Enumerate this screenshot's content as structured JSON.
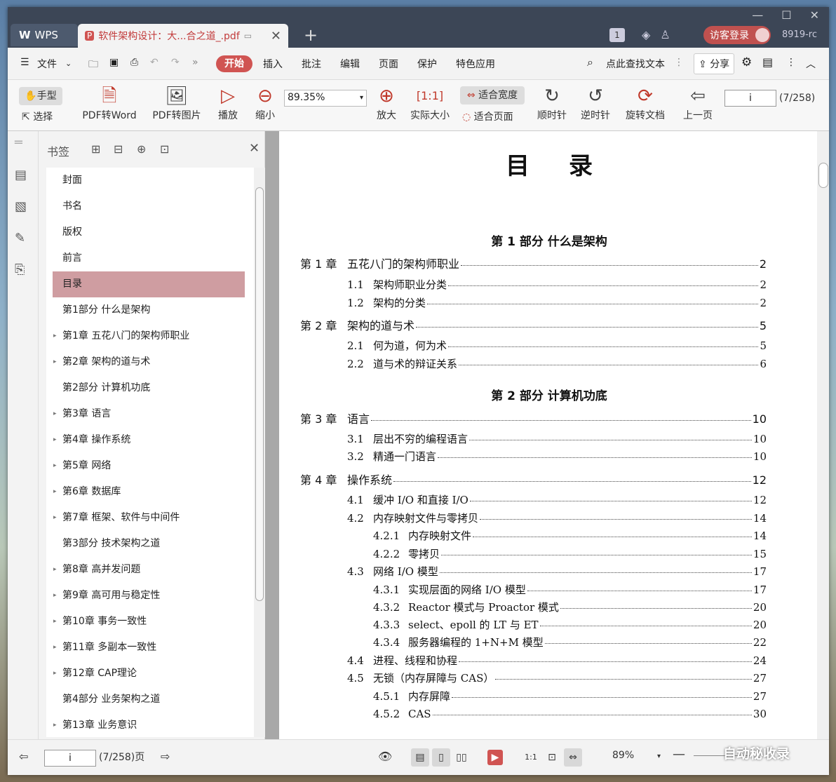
{
  "titlebar": {
    "app_tab": "WPS",
    "doc_tab": "软件架构设计：大...合之道_.pdf",
    "badge": "1",
    "login": "访客登录",
    "version": "8919-rc"
  },
  "menu": {
    "file": "文件",
    "start": "开始",
    "insert": "插入",
    "annotate": "批注",
    "edit": "编辑",
    "page": "页面",
    "protect": "保护",
    "special": "特色应用",
    "search": "点此查找文本",
    "share": "分享"
  },
  "ribbon": {
    "hand": "手型",
    "select": "选择",
    "pdf_word": "PDF转Word",
    "pdf_img": "PDF转图片",
    "play": "播放",
    "zoom_out": "缩小",
    "zoom_value": "89.35%",
    "zoom_in": "放大",
    "actual": "实际大小",
    "fit_width": "适合宽度",
    "fit_page": "适合页面",
    "cw": "顺时针",
    "ccw": "逆时针",
    "rotate": "旋转文档",
    "prev": "上一页",
    "page_input": "i",
    "page_count": "(7/258)"
  },
  "bookmarks": {
    "title": "书签",
    "items": [
      {
        "label": "封面",
        "arrow": ""
      },
      {
        "label": "书名",
        "arrow": ""
      },
      {
        "label": "版权",
        "arrow": ""
      },
      {
        "label": "前言",
        "arrow": ""
      },
      {
        "label": "目录",
        "arrow": "",
        "selected": true
      },
      {
        "label": "第1部分  什么是架构",
        "arrow": ""
      },
      {
        "label": "第1章  五花八门的架构师职业",
        "arrow": "▸"
      },
      {
        "label": "第2章  架构的道与术",
        "arrow": "▸"
      },
      {
        "label": "第2部分  计算机功底",
        "arrow": ""
      },
      {
        "label": "第3章  语言",
        "arrow": "▸"
      },
      {
        "label": "第4章  操作系统",
        "arrow": "▸"
      },
      {
        "label": "第5章  网络",
        "arrow": "▸"
      },
      {
        "label": "第6章  数据库",
        "arrow": "▸"
      },
      {
        "label": "第7章  框架、软件与中间件",
        "arrow": "▸"
      },
      {
        "label": "第3部分  技术架构之道",
        "arrow": ""
      },
      {
        "label": "第8章  高并发问题",
        "arrow": "▸"
      },
      {
        "label": "第9章  高可用与稳定性",
        "arrow": "▸"
      },
      {
        "label": "第10章  事务一致性",
        "arrow": "▸"
      },
      {
        "label": "第11章  多副本一致性",
        "arrow": "▸"
      },
      {
        "label": "第12章  CAP理论",
        "arrow": "▸"
      },
      {
        "label": "第4部分  业务架构之道",
        "arrow": ""
      },
      {
        "label": "第13章  业务意识",
        "arrow": "▸"
      }
    ]
  },
  "doc": {
    "title": "目录",
    "part1": "第 1 部分    什么是架构",
    "part2": "第 2 部分    计算机功底",
    "toc": [
      {
        "num": "第 1 章",
        "text": "五花八门的架构师职业",
        "page": "2",
        "level": 0
      },
      {
        "num": "1.1",
        "text": "架构师职业分类",
        "page": "2",
        "level": 1
      },
      {
        "num": "1.2",
        "text": "架构的分类",
        "page": "2",
        "level": 1
      },
      {
        "num": "第 2 章",
        "text": "架构的道与术",
        "page": "5",
        "level": 0
      },
      {
        "num": "2.1",
        "text": "何为道，何为术",
        "page": "5",
        "level": 1
      },
      {
        "num": "2.2",
        "text": "道与术的辩证关系",
        "page": "6",
        "level": 1
      },
      {
        "num": "第 3 章",
        "text": "语言",
        "page": "10",
        "level": 0
      },
      {
        "num": "3.1",
        "text": "层出不穷的编程语言",
        "page": "10",
        "level": 1
      },
      {
        "num": "3.2",
        "text": "精通一门语言",
        "page": "10",
        "level": 1
      },
      {
        "num": "第 4 章",
        "text": "操作系统",
        "page": "12",
        "level": 0
      },
      {
        "num": "4.1",
        "text": "缓冲 I/O 和直接 I/O",
        "page": "12",
        "level": 1
      },
      {
        "num": "4.2",
        "text": "内存映射文件与零拷贝",
        "page": "14",
        "level": 1
      },
      {
        "num": "4.2.1",
        "text": "内存映射文件",
        "page": "14",
        "level": 2
      },
      {
        "num": "4.2.2",
        "text": "零拷贝",
        "page": "15",
        "level": 2
      },
      {
        "num": "4.3",
        "text": "网络 I/O 模型",
        "page": "17",
        "level": 1
      },
      {
        "num": "4.3.1",
        "text": "实现层面的网络 I/O 模型",
        "page": "17",
        "level": 2
      },
      {
        "num": "4.3.2",
        "text": "Reactor 模式与 Proactor 模式",
        "page": "20",
        "level": 2
      },
      {
        "num": "4.3.3",
        "text": "select、epoll 的 LT 与 ET",
        "page": "20",
        "level": 2
      },
      {
        "num": "4.3.4",
        "text": "服务器编程的 1+N+M 模型",
        "page": "22",
        "level": 2
      },
      {
        "num": "4.4",
        "text": "进程、线程和协程",
        "page": "24",
        "level": 1
      },
      {
        "num": "4.5",
        "text": "无锁（内存屏障与 CAS）",
        "page": "27",
        "level": 1
      },
      {
        "num": "4.5.1",
        "text": "内存屏障",
        "page": "27",
        "level": 2
      },
      {
        "num": "4.5.2",
        "text": "CAS",
        "page": "30",
        "level": 2
      }
    ]
  },
  "status": {
    "page_input": "i",
    "page_info": "(7/258)页",
    "zoom": "89%",
    "watermark": "自动秘收录"
  }
}
